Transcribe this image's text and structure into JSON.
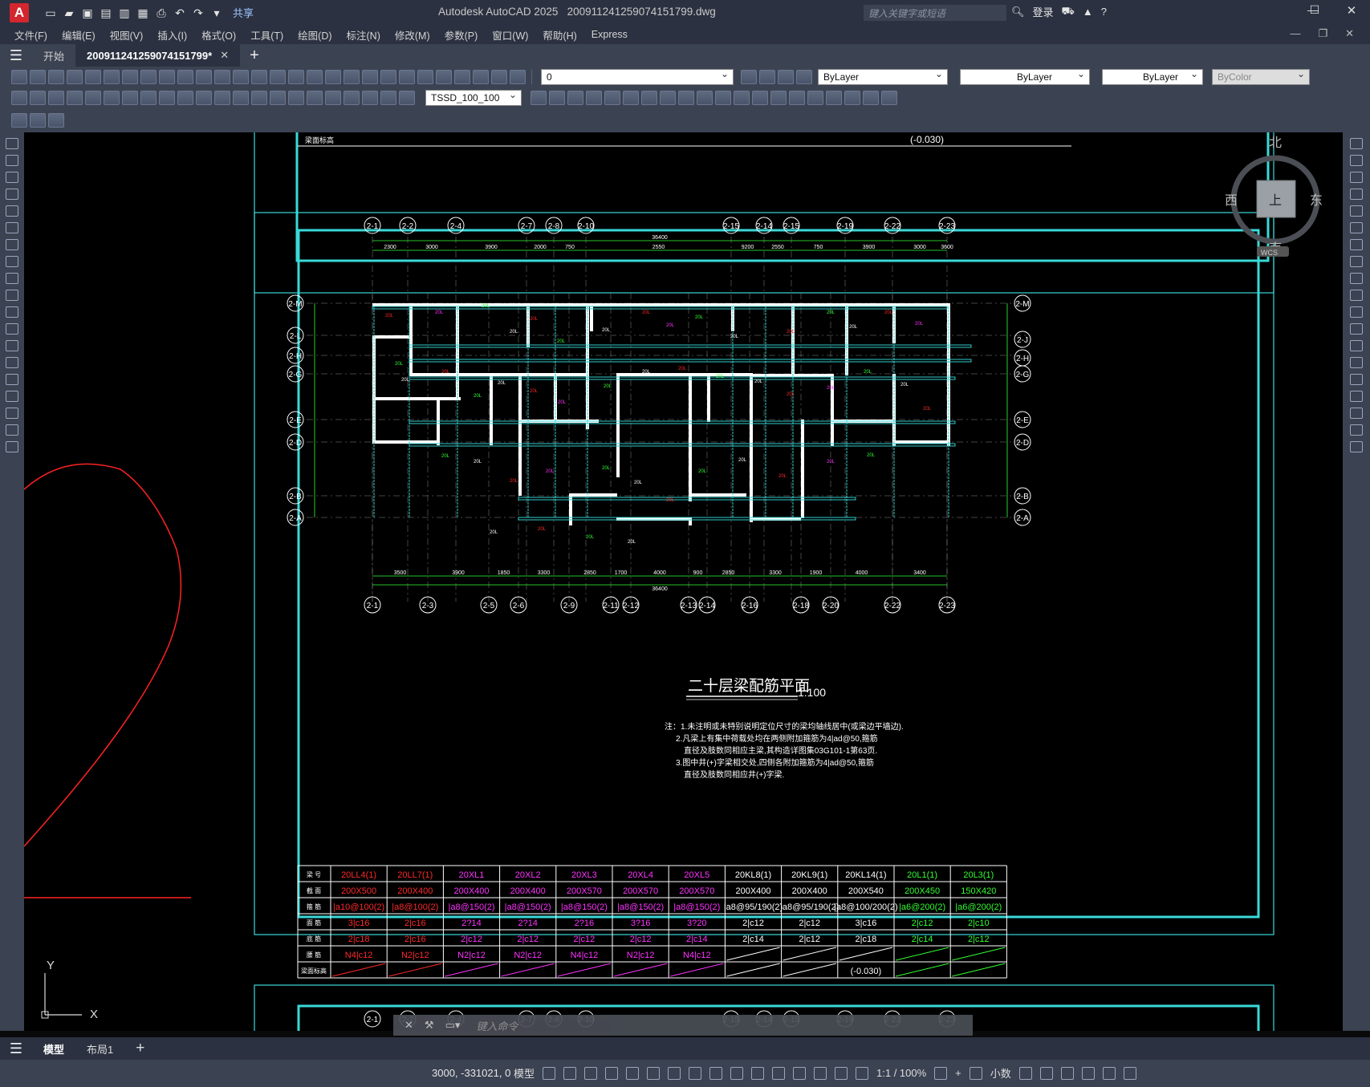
{
  "app": {
    "title": "Autodesk AutoCAD 2025",
    "filename": "20091124125907415179​9.dwg",
    "search_placeholder": "键入关键字或短语",
    "login": "登录",
    "share": "共享"
  },
  "menu": [
    "文件(F)",
    "编辑(E)",
    "视图(V)",
    "插入(I)",
    "格式(O)",
    "工具(T)",
    "绘图(D)",
    "标注(N)",
    "修改(M)",
    "参数(P)",
    "窗口(W)",
    "帮助(H)",
    "Express"
  ],
  "tabs": {
    "start": "开始",
    "doc": "20091124125907415179​9*"
  },
  "props": {
    "layer": "0",
    "color": "ByLayer",
    "linetype": "ByLayer",
    "lineweight": "ByLayer",
    "plot": "ByColor",
    "dimstyle": "TSSD_100_100"
  },
  "viewcube": {
    "n": "北",
    "s": "南",
    "e": "东",
    "w": "西",
    "top": "上",
    "wcs": "WCS"
  },
  "drawing": {
    "title": "二十层梁配筋平面",
    "scale": "1:100",
    "notes": [
      "注：1.未注明或未特别说明定位尺寸的梁均轴线居中(或梁边平墙边).",
      "2.凡梁上有集中荷载处均在两侧附加箍筋为4|ad@50,箍筋",
      "直径及肢数同相应主梁,其构造详图集03G101-1第63页.",
      "3.图中井(+)字梁相交处,四侧各附加箍筋为4|ad@50,箍筋",
      "直径及肢数同相应井(+)字梁."
    ],
    "total_dim": "36400",
    "top_dims": [
      "2300",
      "3000",
      "3900",
      "2000",
      "750",
      "2550",
      "9200",
      "2550",
      "750",
      "3900",
      "3000",
      "3600"
    ],
    "bottom_dims": [
      "3500",
      "3900",
      "1850",
      "3300",
      "2850",
      "1700",
      "4000",
      "900",
      "2850",
      "3300",
      "1900",
      "4000",
      "3400"
    ],
    "top_axes": [
      "2-1",
      "2-2",
      "2-4",
      "2-7",
      "2-8",
      "2-10",
      "2-15",
      "2-14",
      "2-15",
      "2-19",
      "2-22",
      "2-23"
    ],
    "bottom_axes": [
      "2-1",
      "2-3",
      "2-5",
      "2-6",
      "2-9",
      "2-11",
      "2-12",
      "2-13",
      "2-14",
      "2-16",
      "2-18",
      "2-20",
      "2-22",
      "2-23"
    ],
    "left_axes": [
      "2-M",
      "2-L",
      "2-H",
      "2-G",
      "2-E",
      "2-D",
      "2-B",
      "2-A"
    ],
    "right_axes": [
      "2-M",
      "2-J",
      "2-H",
      "2-G",
      "2-E",
      "2-D",
      "2-B",
      "2-A"
    ],
    "table": {
      "row_labels": [
        "梁 号",
        "截 面",
        "箍 筋",
        "面 筋",
        "底 筋",
        "腰 筋",
        "梁面标高"
      ],
      "cols": [
        {
          "c": "#ff2a2a",
          "v": [
            "20LL4(1)",
            "200X500",
            "|a10@100(2)",
            "3|c16",
            "2|c18",
            "N4|c12",
            ""
          ]
        },
        {
          "c": "#ff2a2a",
          "v": [
            "20LL7(1)",
            "200X400",
            "|a8@100(2)",
            "2|c16",
            "2|c16",
            "N2|c12",
            ""
          ]
        },
        {
          "c": "#ff33ff",
          "v": [
            "20XL1",
            "200X400",
            "|a8@150(2)",
            "2?14",
            "2|c12",
            "N2|c12",
            ""
          ]
        },
        {
          "c": "#ff33ff",
          "v": [
            "20XL2",
            "200X400",
            "|a8@150(2)",
            "2?14",
            "2|c12",
            "N2|c12",
            ""
          ]
        },
        {
          "c": "#ff33ff",
          "v": [
            "20XL3",
            "200X570",
            "|a8@150(2)",
            "2?16",
            "2|c12",
            "N4|c12",
            ""
          ]
        },
        {
          "c": "#ff33ff",
          "v": [
            "20XL4",
            "200X570",
            "|a8@150(2)",
            "3?16",
            "2|c12",
            "N2|c12",
            ""
          ]
        },
        {
          "c": "#ff33ff",
          "v": [
            "20XL5",
            "200X570",
            "|a8@150(2)",
            "3?20",
            "2|c14",
            "N4|c12",
            ""
          ]
        },
        {
          "c": "#ffffff",
          "v": [
            "20KL8(1)",
            "200X400",
            "|a8@95/190(2)",
            "2|c12",
            "2|c14",
            "",
            ""
          ]
        },
        {
          "c": "#ffffff",
          "v": [
            "20KL9(1)",
            "200X400",
            "|a8@95/190(2)",
            "2|c12",
            "2|c12",
            "",
            ""
          ]
        },
        {
          "c": "#ffffff",
          "v": [
            "20KL14(1)",
            "200X540",
            "|a8@100/200(2)",
            "3|c16",
            "2|c18",
            "",
            "(-0.030)"
          ]
        },
        {
          "c": "#33ff33",
          "v": [
            "20L1(1)",
            "200X450",
            "|a6@200(2)",
            "2|c12",
            "2|c14",
            "",
            ""
          ]
        },
        {
          "c": "#33ff33",
          "v": [
            "20L3(1)",
            "150X420",
            "|a6@200(2)",
            "2|c10",
            "2|c12",
            "",
            ""
          ]
        }
      ]
    },
    "top_frame_text": "(-0.030)"
  },
  "cmd": {
    "placeholder": "键入命令"
  },
  "layout_tabs": [
    "模型",
    "布局1"
  ],
  "status": {
    "coords": "3000, -331021, 0",
    "model": "模型",
    "scale": "1:1 / 100%",
    "units": "小数"
  },
  "ucs": {
    "x": "X",
    "y": "Y"
  }
}
